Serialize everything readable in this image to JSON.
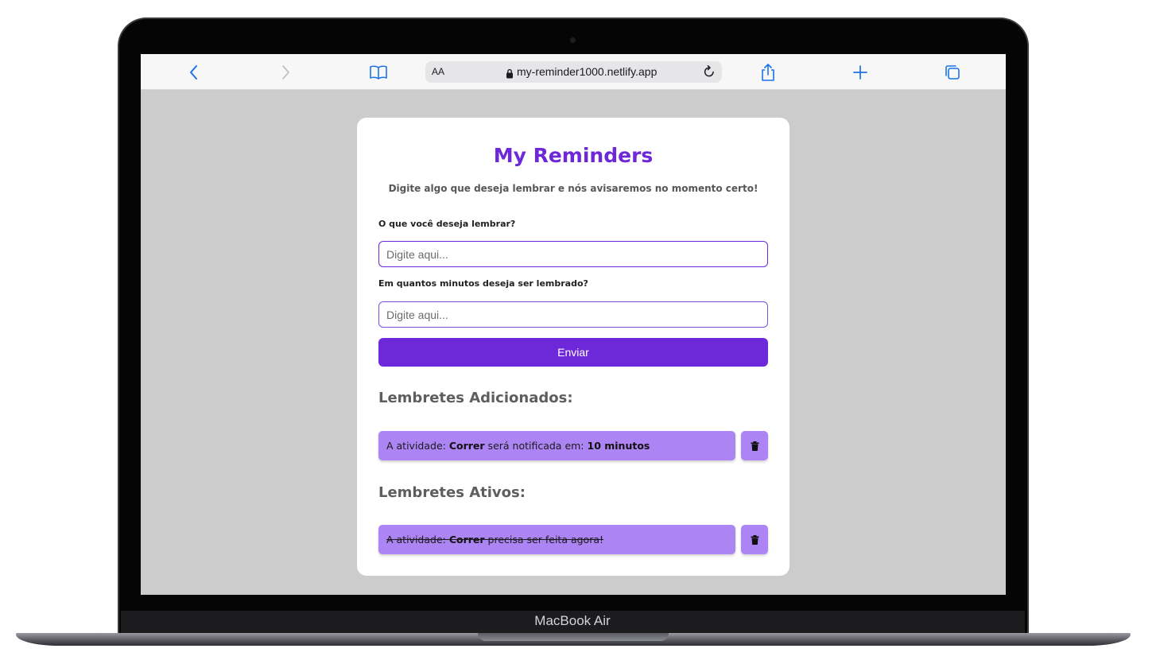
{
  "device": {
    "label": "MacBook Air"
  },
  "browser": {
    "text_size_label": "AA",
    "url": "my-reminder1000.netlify.app",
    "icons": {
      "back": "chevron-left-icon",
      "forward": "chevron-right-icon",
      "bookmarks": "book-icon",
      "secure": "lock-icon",
      "reload": "reload-icon",
      "share": "share-icon",
      "new_tab": "plus-icon",
      "tabs": "tabs-icon"
    },
    "accent_color": "#1a73e8"
  },
  "app": {
    "title": "My Reminders",
    "subtitle": "Digite algo que deseja lembrar e nós avisaremos no momento certo!",
    "form": {
      "reminder_label": "O que você deseja lembrar?",
      "reminder_placeholder": "Digite aqui...",
      "reminder_value": "",
      "minutes_label": "Em quantos minutos deseja ser lembrado?",
      "minutes_placeholder": "Digite aqui...",
      "minutes_value": "",
      "submit_label": "Enviar"
    },
    "added_section": {
      "heading": "Lembretes Adicionados:",
      "items": [
        {
          "prefix": "A atividade: ",
          "activity": "Correr",
          "middle": " será notificada em: ",
          "time": "10 minutos"
        }
      ]
    },
    "active_section": {
      "heading": "Lembretes Ativos:",
      "items": [
        {
          "prefix": "A atividade: ",
          "activity": "Correr",
          "suffix": " precisa ser feita agora!"
        }
      ]
    },
    "colors": {
      "primary": "#6d28d9",
      "item_background": "#ad84f3",
      "page_background": "#cccccc"
    }
  }
}
